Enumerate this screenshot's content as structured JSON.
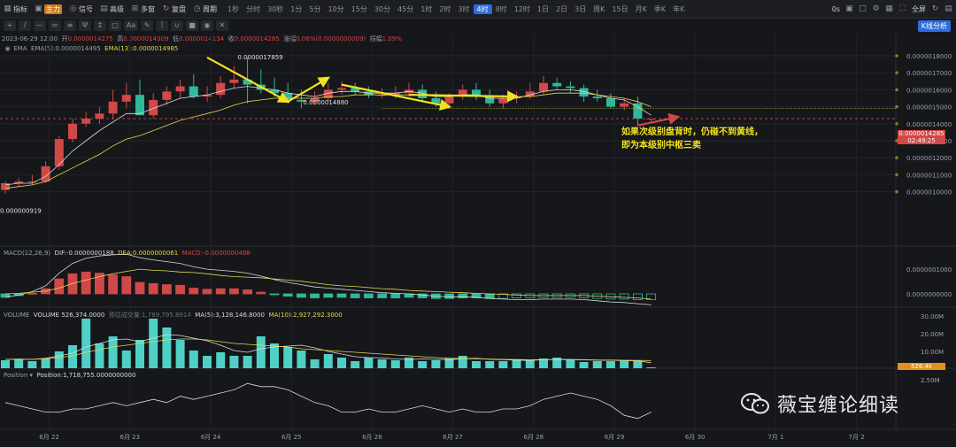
{
  "toolbar": {
    "items": [
      {
        "label": "指标",
        "icon": "grid-icon"
      },
      {
        "label": "主力",
        "icon": "badge-icon"
      },
      {
        "label": "信号",
        "icon": "signal-icon"
      },
      {
        "label": "高级",
        "icon": "advanced-icon"
      },
      {
        "label": "多窗",
        "icon": "multiwindow-icon"
      },
      {
        "label": "复盘",
        "icon": "replay-icon"
      },
      {
        "label": "周期",
        "icon": "period-icon"
      }
    ],
    "intervals": [
      "1秒",
      "分时",
      "30秒",
      "1分",
      "5分",
      "10分",
      "15分",
      "30分",
      "45分",
      "1时",
      "2时",
      "3时",
      "4时",
      "8时",
      "12时",
      "1日",
      "2日",
      "3日",
      "周K",
      "15日",
      "月K",
      "季K",
      "年K"
    ],
    "active_interval": "4时",
    "right": {
      "countdown": "0s",
      "fullscreen_label": "全屏"
    }
  },
  "drawbar": {
    "text_tool": "Aa",
    "kline_button": "K线分析"
  },
  "info": {
    "date": "2023-06-29 12:00",
    "open_label": "开",
    "open": "0.0000014275",
    "high_label": "高",
    "high": "0.0000014309",
    "low_label": "低",
    "low": "0.0000014134",
    "close_label": "收",
    "close": "0.0000014285",
    "change_label": "涨幅",
    "change": "0.06%(0.0000000009)",
    "amplitude_label": "振幅",
    "amplitude": "1.09%"
  },
  "ema": {
    "label": "EMA",
    "ema5": "EMA(5):0.0000014495",
    "ema13": "EMA(13):0.0000014985"
  },
  "macd": {
    "label": "MACD(12,26,9)",
    "dif": "DIF:-0.0000000188",
    "dea": "DEA:0.0000000061",
    "macd": "MACD:-0.0000000498"
  },
  "volume": {
    "label": "VOLUME",
    "vol": "VOLUME 526,374.0000",
    "est": "预估成交量:1,789,795.8914",
    "ma5": "MA(5):3,128,146.8000",
    "ma10": "MA(10):2,927,292.3000"
  },
  "position": {
    "label": "Position",
    "value": "Position:1,718,755.0000000000"
  },
  "price_axis": {
    "labels": [
      "0.0000018000",
      "0.0000017000",
      "0.0000016000",
      "0.0000015000",
      "0.0000014000",
      "0.0000013000",
      "0.0000012000",
      "0.0000011000",
      "0.0000010000"
    ],
    "last_price": "0.0000014285",
    "countdown": "02:49:25"
  },
  "macd_axis": [
    "0.0000001000",
    "0.0000000000"
  ],
  "volume_axis": [
    "30.00M",
    "20.00M",
    "10.00M"
  ],
  "volume_badge": "526.4k",
  "position_axis": [
    "2.50M"
  ],
  "date_axis": [
    "6月 22",
    "6月 23",
    "6月 24",
    "6月 25",
    "6月 26",
    "6月 27",
    "6月 28",
    "6月 29",
    "6月 30",
    "7月 1",
    "7月 2"
  ],
  "annotations": {
    "high": "0.0000017859",
    "mid": "0.0000014880",
    "low": "0.000000919",
    "note_line1": "如果次级别盘背时，仍碰不到黄线，",
    "note_line2": "即为本级别中枢三卖"
  },
  "watermark": "薇宝缠论细读",
  "colors": {
    "up": "#d04848",
    "down": "#2fb89a",
    "yellow": "#f2e21e",
    "background": "#15171b",
    "accent": "#2f6bdc"
  },
  "chart_data": {
    "type": "candlestick",
    "timeframe": "4h",
    "x": [
      "6-21 12:00",
      "6-21 16:00",
      "6-21 20:00",
      "6-22 00:00",
      "6-22 04:00",
      "6-22 08:00",
      "6-22 12:00",
      "6-22 16:00",
      "6-22 20:00",
      "6-23 00:00",
      "6-23 04:00",
      "6-23 08:00",
      "6-23 12:00",
      "6-23 16:00",
      "6-23 20:00",
      "6-24 00:00",
      "6-24 04:00",
      "6-24 08:00",
      "6-24 12:00",
      "6-24 16:00",
      "6-24 20:00",
      "6-25 00:00",
      "6-25 04:00",
      "6-25 08:00",
      "6-25 12:00",
      "6-25 16:00",
      "6-25 20:00",
      "6-26 00:00",
      "6-26 04:00",
      "6-26 08:00",
      "6-26 12:00",
      "6-26 16:00",
      "6-26 20:00",
      "6-27 00:00",
      "6-27 04:00",
      "6-27 08:00",
      "6-27 12:00",
      "6-27 16:00",
      "6-27 20:00",
      "6-28 00:00",
      "6-28 04:00",
      "6-28 08:00",
      "6-28 12:00",
      "6-28 16:00",
      "6-28 20:00",
      "6-29 00:00",
      "6-29 04:00",
      "6-29 08:00",
      "6-29 12:00"
    ],
    "open": [
      1.01,
      1.05,
      1.06,
      1.06,
      1.15,
      1.31,
      1.4,
      1.43,
      1.46,
      1.53,
      1.57,
      1.45,
      1.54,
      1.59,
      1.62,
      1.56,
      1.57,
      1.64,
      1.66,
      1.63,
      1.6,
      1.58,
      1.54,
      1.53,
      1.55,
      1.6,
      1.61,
      1.59,
      1.57,
      1.57,
      1.58,
      1.6,
      1.55,
      1.52,
      1.56,
      1.6,
      1.56,
      1.52,
      1.55,
      1.56,
      1.59,
      1.64,
      1.62,
      1.61,
      1.56,
      1.55,
      1.5,
      1.52,
      1.43
    ],
    "high": [
      1.06,
      1.08,
      1.1,
      1.18,
      1.33,
      1.43,
      1.47,
      1.5,
      1.6,
      1.64,
      1.66,
      1.58,
      1.62,
      1.66,
      1.69,
      1.62,
      1.68,
      1.74,
      1.79,
      1.72,
      1.67,
      1.64,
      1.6,
      1.59,
      1.64,
      1.65,
      1.64,
      1.62,
      1.61,
      1.62,
      1.64,
      1.63,
      1.59,
      1.58,
      1.63,
      1.64,
      1.6,
      1.57,
      1.59,
      1.64,
      1.68,
      1.67,
      1.65,
      1.63,
      1.6,
      1.58,
      1.55,
      1.56,
      1.43
    ],
    "low": [
      0.99,
      1.03,
      1.04,
      1.05,
      1.13,
      1.29,
      1.38,
      1.4,
      1.43,
      1.49,
      1.54,
      1.43,
      1.51,
      1.55,
      1.55,
      1.53,
      1.55,
      1.61,
      1.52,
      1.58,
      1.56,
      1.52,
      1.49,
      1.51,
      1.53,
      1.57,
      1.57,
      1.55,
      1.55,
      1.55,
      1.56,
      1.53,
      1.5,
      1.5,
      1.54,
      1.54,
      1.5,
      1.49,
      1.52,
      1.55,
      1.57,
      1.6,
      1.58,
      1.53,
      1.53,
      1.49,
      1.48,
      1.39,
      1.41
    ],
    "close": [
      1.05,
      1.06,
      1.06,
      1.15,
      1.31,
      1.4,
      1.43,
      1.46,
      1.53,
      1.57,
      1.45,
      1.54,
      1.59,
      1.62,
      1.56,
      1.57,
      1.64,
      1.66,
      1.63,
      1.6,
      1.58,
      1.54,
      1.53,
      1.55,
      1.6,
      1.61,
      1.59,
      1.57,
      1.57,
      1.58,
      1.6,
      1.55,
      1.52,
      1.56,
      1.6,
      1.56,
      1.52,
      1.55,
      1.56,
      1.59,
      1.64,
      1.62,
      1.61,
      1.56,
      1.55,
      1.5,
      1.52,
      1.43,
      1.43
    ],
    "price_unit": "1e-6",
    "ema5": [
      1.04,
      1.05,
      1.05,
      1.09,
      1.16,
      1.24,
      1.3,
      1.36,
      1.41,
      1.46,
      1.46,
      1.49,
      1.52,
      1.55,
      1.56,
      1.57,
      1.59,
      1.61,
      1.62,
      1.61,
      1.6,
      1.58,
      1.57,
      1.56,
      1.58,
      1.59,
      1.59,
      1.58,
      1.58,
      1.58,
      1.59,
      1.58,
      1.56,
      1.56,
      1.57,
      1.57,
      1.55,
      1.55,
      1.55,
      1.57,
      1.59,
      1.6,
      1.6,
      1.59,
      1.57,
      1.55,
      1.54,
      1.5,
      1.45
    ],
    "ema13": [
      1.02,
      1.03,
      1.04,
      1.06,
      1.1,
      1.14,
      1.18,
      1.22,
      1.27,
      1.31,
      1.33,
      1.36,
      1.39,
      1.42,
      1.44,
      1.46,
      1.48,
      1.51,
      1.53,
      1.54,
      1.55,
      1.55,
      1.55,
      1.55,
      1.56,
      1.56,
      1.57,
      1.57,
      1.57,
      1.57,
      1.57,
      1.57,
      1.56,
      1.56,
      1.57,
      1.57,
      1.56,
      1.56,
      1.56,
      1.56,
      1.57,
      1.58,
      1.58,
      1.58,
      1.57,
      1.56,
      1.55,
      1.53,
      1.5
    ],
    "macd_hist": [
      -0.6,
      -0.3,
      0.1,
      0.9,
      2.6,
      3.5,
      3.8,
      3.6,
      3.3,
      3.0,
      2.0,
      1.8,
      1.6,
      1.5,
      1.0,
      0.8,
      0.9,
      0.9,
      0.7,
      0.3,
      -0.1,
      -0.4,
      -0.6,
      -0.7,
      -0.6,
      -0.6,
      -0.7,
      -0.7,
      -0.7,
      -0.7,
      -0.6,
      -0.7,
      -0.8,
      -0.8,
      -0.7,
      -0.7,
      -0.8,
      -0.8,
      -0.7,
      -0.7,
      -0.6,
      -0.6,
      -0.6,
      -0.7,
      -0.8,
      -0.9,
      -0.9,
      -1.0,
      -1.0
    ],
    "macd_dif": [
      -0.6,
      -0.2,
      0.4,
      1.4,
      3.6,
      5.3,
      6.2,
      6.6,
      6.8,
      6.9,
      6.3,
      5.9,
      5.6,
      5.3,
      4.7,
      4.3,
      4.1,
      3.9,
      3.6,
      3.1,
      2.5,
      2.0,
      1.6,
      1.2,
      1.0,
      0.8,
      0.6,
      0.4,
      0.2,
      0.1,
      0.0,
      -0.2,
      -0.4,
      -0.5,
      -0.5,
      -0.6,
      -0.8,
      -0.9,
      -1.0,
      -1.0,
      -0.9,
      -0.9,
      -0.9,
      -1.0,
      -1.2,
      -1.4,
      -1.5,
      -1.7,
      -1.9
    ],
    "macd_dea": [
      0.0,
      0.1,
      0.3,
      0.5,
      1.0,
      1.8,
      2.4,
      3.0,
      3.5,
      3.9,
      4.3,
      4.1,
      4.0,
      3.8,
      3.7,
      3.5,
      3.2,
      3.0,
      2.9,
      2.8,
      2.6,
      2.4,
      2.2,
      1.9,
      1.6,
      1.4,
      1.3,
      1.1,
      0.9,
      0.8,
      0.6,
      0.5,
      0.4,
      0.3,
      0.2,
      0.1,
      0.0,
      -0.1,
      -0.2,
      -0.3,
      -0.3,
      -0.3,
      -0.3,
      -0.3,
      -0.4,
      -0.5,
      -0.6,
      -0.7,
      -0.9
    ],
    "volume": [
      4.5,
      5.0,
      4.0,
      5.5,
      9.5,
      13.0,
      28.0,
      14.0,
      18.0,
      10.0,
      16.0,
      28.0,
      23.0,
      16.0,
      10.0,
      7.0,
      9.0,
      7.0,
      7.0,
      18.0,
      14.0,
      12.0,
      10.0,
      5.0,
      8.0,
      6.0,
      4.0,
      6.0,
      5.0,
      4.5,
      6.0,
      4.0,
      4.5,
      5.5,
      7.0,
      4.0,
      4.0,
      4.0,
      4.5,
      4.5,
      5.5,
      6.0,
      5.0,
      3.5,
      4.0,
      4.0,
      4.5,
      4.0,
      0.5
    ],
    "volume_unit": "M",
    "volume_ma5": [
      5.0,
      5.2,
      5.0,
      5.6,
      7.0,
      8.5,
      12.0,
      14.0,
      16.0,
      16.5,
      15.0,
      17.0,
      19.0,
      18.5,
      17.0,
      15.5,
      13.0,
      10.0,
      9.0,
      11.0,
      12.0,
      12.5,
      13.0,
      11.5,
      9.5,
      8.0,
      6.5,
      6.0,
      5.8,
      5.2,
      5.0,
      5.2,
      5.0,
      4.8,
      5.4,
      5.6,
      5.0,
      4.8,
      4.6,
      4.4,
      4.8,
      5.0,
      5.0,
      4.8,
      4.6,
      4.5,
      4.3,
      4.2,
      3.1
    ],
    "volume_ma10": [
      5.0,
      5.1,
      5.0,
      5.3,
      6.0,
      7.0,
      9.0,
      10.5,
      12.0,
      13.0,
      14.0,
      15.0,
      16.0,
      16.5,
      16.5,
      16.0,
      15.0,
      14.0,
      13.5,
      13.0,
      12.5,
      12.0,
      11.0,
      10.5,
      10.0,
      9.5,
      9.0,
      8.5,
      8.0,
      7.5,
      7.0,
      6.5,
      6.0,
      5.6,
      5.4,
      5.3,
      5.2,
      5.0,
      4.9,
      4.8,
      4.8,
      4.8,
      4.8,
      4.7,
      4.6,
      4.6,
      4.5,
      4.4,
      4.3
    ],
    "position_series": [
      7,
      6,
      5,
      4,
      4,
      5,
      5,
      6,
      7,
      6,
      7,
      8,
      7,
      9,
      8,
      9,
      10,
      11,
      13,
      12,
      12,
      11,
      9,
      7,
      6,
      4,
      4,
      5,
      4,
      4,
      5,
      6,
      5,
      4,
      5,
      4,
      4,
      5,
      5,
      6,
      8,
      9,
      10,
      9,
      8,
      6,
      3,
      2,
      4
    ],
    "ylim": [
      0.89,
      1.84
    ],
    "annotations": [
      {
        "type": "arrow",
        "color": "yellow",
        "from": {
          "x": "6-24 00:00",
          "y": 1.79
        },
        "to": {
          "x": "6-25 00:00",
          "y": 1.53
        }
      },
      {
        "type": "arrow",
        "color": "yellow",
        "from": {
          "x": "6-25 00:00",
          "y": 1.53
        },
        "to": {
          "x": "6-25 12:00",
          "y": 1.67
        }
      },
      {
        "type": "arrow",
        "color": "yellow",
        "from": {
          "x": "6-25 16:00",
          "y": 1.63
        },
        "to": {
          "x": "6-27 00:00",
          "y": 1.5
        }
      },
      {
        "type": "arrow",
        "color": "yellow",
        "from": {
          "x": "6-26 12:00",
          "y": 1.57
        },
        "to": {
          "x": "6-27 20:00",
          "y": 1.56
        }
      },
      {
        "type": "arrow",
        "color": "red",
        "from": {
          "x": "6-29 08:00",
          "y": 1.39
        },
        "to": {
          "x": "6-29 16:00",
          "y": 1.44
        }
      },
      {
        "type": "hline",
        "style": "dotted",
        "color": "yellow",
        "y": 1.49
      },
      {
        "type": "hline",
        "style": "dashed",
        "color": "red",
        "y": 1.43
      }
    ]
  }
}
